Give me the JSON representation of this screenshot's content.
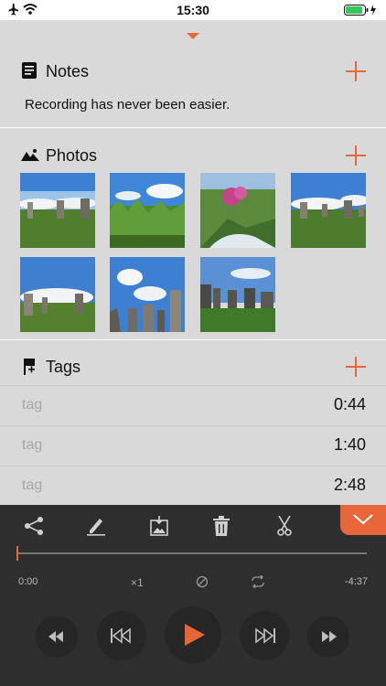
{
  "status_bar": {
    "time": "15:30"
  },
  "notes": {
    "title": "Notes",
    "text": "Recording has never been easier."
  },
  "photos": {
    "title": "Photos",
    "count": 7
  },
  "tags": {
    "title": "Tags",
    "rows": [
      {
        "label": "tag",
        "time": "0:44"
      },
      {
        "label": "tag",
        "time": "1:40"
      },
      {
        "label": "tag",
        "time": "2:48"
      }
    ]
  },
  "player": {
    "tools": [
      "share-icon",
      "pencil-icon",
      "image-export-icon",
      "trash-icon",
      "scissors-icon"
    ],
    "current_time": "0:00",
    "speed": "×1",
    "remaining_time": "-4:37"
  },
  "colors": {
    "accent": "#e8673a",
    "background": "#d9d9d9",
    "player_bg": "#2e2e2e"
  }
}
